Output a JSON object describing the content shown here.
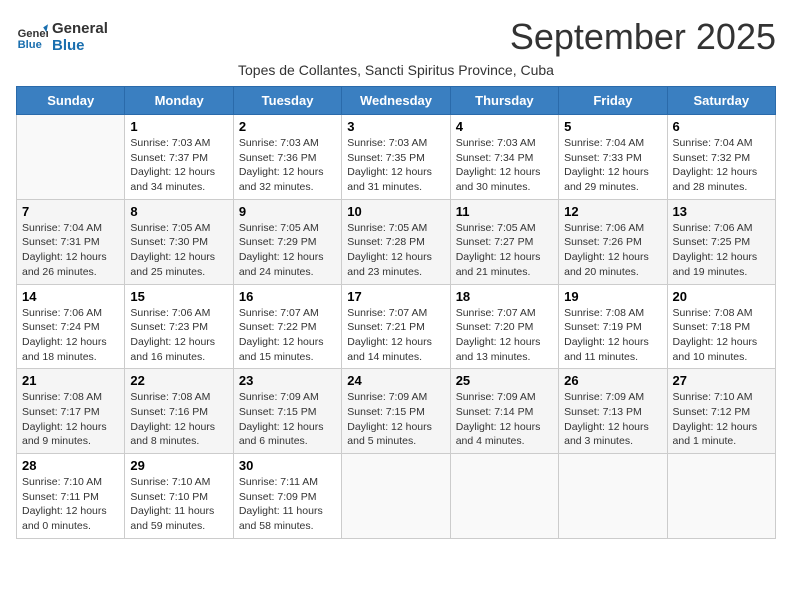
{
  "header": {
    "logo_line1": "General",
    "logo_line2": "Blue",
    "month_title": "September 2025",
    "subtitle": "Topes de Collantes, Sancti Spiritus Province, Cuba"
  },
  "columns": [
    "Sunday",
    "Monday",
    "Tuesday",
    "Wednesday",
    "Thursday",
    "Friday",
    "Saturday"
  ],
  "weeks": [
    [
      {
        "day": "",
        "info": ""
      },
      {
        "day": "1",
        "info": "Sunrise: 7:03 AM\nSunset: 7:37 PM\nDaylight: 12 hours\nand 34 minutes."
      },
      {
        "day": "2",
        "info": "Sunrise: 7:03 AM\nSunset: 7:36 PM\nDaylight: 12 hours\nand 32 minutes."
      },
      {
        "day": "3",
        "info": "Sunrise: 7:03 AM\nSunset: 7:35 PM\nDaylight: 12 hours\nand 31 minutes."
      },
      {
        "day": "4",
        "info": "Sunrise: 7:03 AM\nSunset: 7:34 PM\nDaylight: 12 hours\nand 30 minutes."
      },
      {
        "day": "5",
        "info": "Sunrise: 7:04 AM\nSunset: 7:33 PM\nDaylight: 12 hours\nand 29 minutes."
      },
      {
        "day": "6",
        "info": "Sunrise: 7:04 AM\nSunset: 7:32 PM\nDaylight: 12 hours\nand 28 minutes."
      }
    ],
    [
      {
        "day": "7",
        "info": "Sunrise: 7:04 AM\nSunset: 7:31 PM\nDaylight: 12 hours\nand 26 minutes."
      },
      {
        "day": "8",
        "info": "Sunrise: 7:05 AM\nSunset: 7:30 PM\nDaylight: 12 hours\nand 25 minutes."
      },
      {
        "day": "9",
        "info": "Sunrise: 7:05 AM\nSunset: 7:29 PM\nDaylight: 12 hours\nand 24 minutes."
      },
      {
        "day": "10",
        "info": "Sunrise: 7:05 AM\nSunset: 7:28 PM\nDaylight: 12 hours\nand 23 minutes."
      },
      {
        "day": "11",
        "info": "Sunrise: 7:05 AM\nSunset: 7:27 PM\nDaylight: 12 hours\nand 21 minutes."
      },
      {
        "day": "12",
        "info": "Sunrise: 7:06 AM\nSunset: 7:26 PM\nDaylight: 12 hours\nand 20 minutes."
      },
      {
        "day": "13",
        "info": "Sunrise: 7:06 AM\nSunset: 7:25 PM\nDaylight: 12 hours\nand 19 minutes."
      }
    ],
    [
      {
        "day": "14",
        "info": "Sunrise: 7:06 AM\nSunset: 7:24 PM\nDaylight: 12 hours\nand 18 minutes."
      },
      {
        "day": "15",
        "info": "Sunrise: 7:06 AM\nSunset: 7:23 PM\nDaylight: 12 hours\nand 16 minutes."
      },
      {
        "day": "16",
        "info": "Sunrise: 7:07 AM\nSunset: 7:22 PM\nDaylight: 12 hours\nand 15 minutes."
      },
      {
        "day": "17",
        "info": "Sunrise: 7:07 AM\nSunset: 7:21 PM\nDaylight: 12 hours\nand 14 minutes."
      },
      {
        "day": "18",
        "info": "Sunrise: 7:07 AM\nSunset: 7:20 PM\nDaylight: 12 hours\nand 13 minutes."
      },
      {
        "day": "19",
        "info": "Sunrise: 7:08 AM\nSunset: 7:19 PM\nDaylight: 12 hours\nand 11 minutes."
      },
      {
        "day": "20",
        "info": "Sunrise: 7:08 AM\nSunset: 7:18 PM\nDaylight: 12 hours\nand 10 minutes."
      }
    ],
    [
      {
        "day": "21",
        "info": "Sunrise: 7:08 AM\nSunset: 7:17 PM\nDaylight: 12 hours\nand 9 minutes."
      },
      {
        "day": "22",
        "info": "Sunrise: 7:08 AM\nSunset: 7:16 PM\nDaylight: 12 hours\nand 8 minutes."
      },
      {
        "day": "23",
        "info": "Sunrise: 7:09 AM\nSunset: 7:15 PM\nDaylight: 12 hours\nand 6 minutes."
      },
      {
        "day": "24",
        "info": "Sunrise: 7:09 AM\nSunset: 7:15 PM\nDaylight: 12 hours\nand 5 minutes."
      },
      {
        "day": "25",
        "info": "Sunrise: 7:09 AM\nSunset: 7:14 PM\nDaylight: 12 hours\nand 4 minutes."
      },
      {
        "day": "26",
        "info": "Sunrise: 7:09 AM\nSunset: 7:13 PM\nDaylight: 12 hours\nand 3 minutes."
      },
      {
        "day": "27",
        "info": "Sunrise: 7:10 AM\nSunset: 7:12 PM\nDaylight: 12 hours\nand 1 minute."
      }
    ],
    [
      {
        "day": "28",
        "info": "Sunrise: 7:10 AM\nSunset: 7:11 PM\nDaylight: 12 hours\nand 0 minutes."
      },
      {
        "day": "29",
        "info": "Sunrise: 7:10 AM\nSunset: 7:10 PM\nDaylight: 11 hours\nand 59 minutes."
      },
      {
        "day": "30",
        "info": "Sunrise: 7:11 AM\nSunset: 7:09 PM\nDaylight: 11 hours\nand 58 minutes."
      },
      {
        "day": "",
        "info": ""
      },
      {
        "day": "",
        "info": ""
      },
      {
        "day": "",
        "info": ""
      },
      {
        "day": "",
        "info": ""
      }
    ]
  ]
}
